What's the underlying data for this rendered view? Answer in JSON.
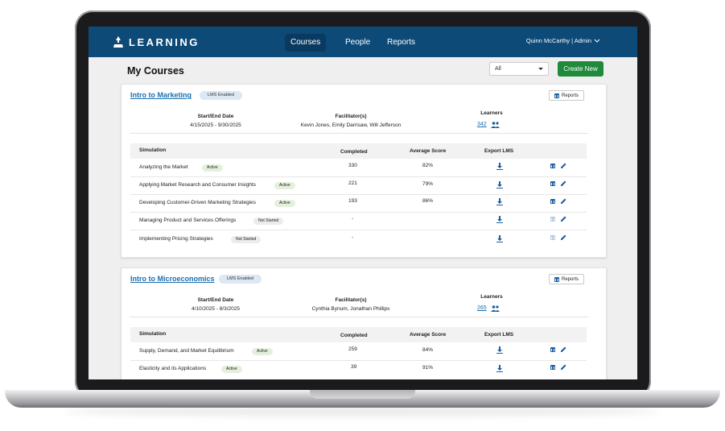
{
  "nav": {
    "brand": "LEARNING",
    "items": [
      {
        "label": "Courses",
        "active": true
      },
      {
        "label": "People",
        "active": false
      },
      {
        "label": "Reports",
        "active": false
      }
    ],
    "user": "Quinn McCarthy | Admin"
  },
  "page": {
    "title": "My Courses",
    "filter_value": "All",
    "create_label": "Create New"
  },
  "colors": {
    "nav_bg": "#0d4a78",
    "link": "#1a6fb0",
    "create_button": "#1f8a3a",
    "active_badge": "#e4f0dc",
    "lms_badge": "#dce8f3"
  },
  "labels": {
    "start_end": "Start/End Date",
    "facilitators": "Facilitator(s)",
    "learners": "Learners",
    "reports": "Reports",
    "col_simulation": "Simulation",
    "col_completed": "Completed",
    "col_average": "Average Score",
    "col_export": "Export LMS"
  },
  "courses": [
    {
      "title": "Intro to Marketing",
      "badge": "LMS Enabled",
      "dates": "4/15/2025 - 9/30/2025",
      "facilitators": "Kevin Jones, Emily Darrisaw, Will Jefferson",
      "learners": "342",
      "simulations": [
        {
          "name": "Analyzing the Market",
          "status": "Active",
          "completed": "330",
          "average": "82%"
        },
        {
          "name": "Applying Market Research and Consumer Insights",
          "status": "Active",
          "completed": "221",
          "average": "79%"
        },
        {
          "name": "Developing Customer-Driven Marketing Strategies",
          "status": "Active",
          "completed": "193",
          "average": "86%"
        },
        {
          "name": "Managing Product and Services Offerings",
          "status": "Not Started",
          "completed": "-",
          "average": ""
        },
        {
          "name": "Implementing Pricing Strategies",
          "status": "Not Started",
          "completed": "-",
          "average": ""
        }
      ]
    },
    {
      "title": "Intro to Microeconomics",
      "badge": "LMS Enabled",
      "dates": "4/10/2025 - 8/3/2025",
      "facilitators": "Cynthia Bynum, Jonathan Phillips",
      "learners": "265",
      "simulations": [
        {
          "name": "Supply, Demand, and Market Equilibrium",
          "status": "Active",
          "completed": "259",
          "average": "84%"
        },
        {
          "name": "Elasticity and its Applications",
          "status": "Active",
          "completed": "39",
          "average": "91%"
        }
      ]
    }
  ]
}
